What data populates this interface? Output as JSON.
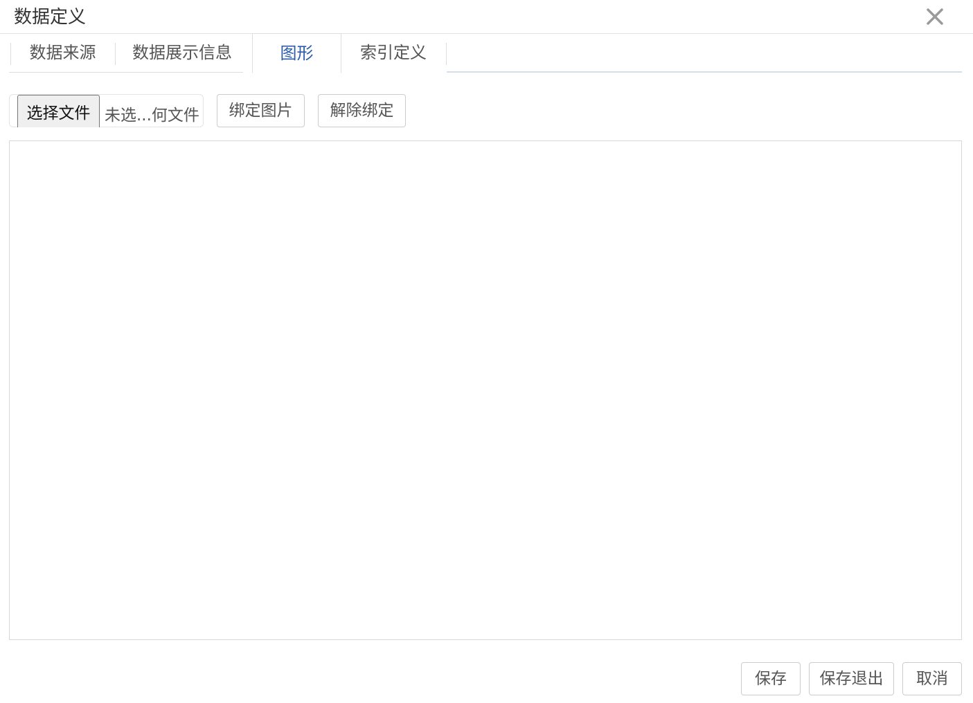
{
  "dialog": {
    "title": "数据定义",
    "close_icon": "close-icon"
  },
  "tabs": [
    {
      "label": "数据来源",
      "active": false
    },
    {
      "label": "数据展示信息",
      "active": false
    },
    {
      "label": "图形",
      "active": true
    },
    {
      "label": "索引定义",
      "active": false
    }
  ],
  "toolbar": {
    "choose_file_label": "选择文件",
    "file_status": "未选...何文件",
    "bind_image_label": "绑定图片",
    "unbind_label": "解除绑定"
  },
  "footer": {
    "save_label": "保存",
    "save_exit_label": "保存退出",
    "cancel_label": "取消"
  },
  "colors": {
    "active_tab": "#2a5caa",
    "text": "#333333",
    "border": "#cccccc"
  }
}
